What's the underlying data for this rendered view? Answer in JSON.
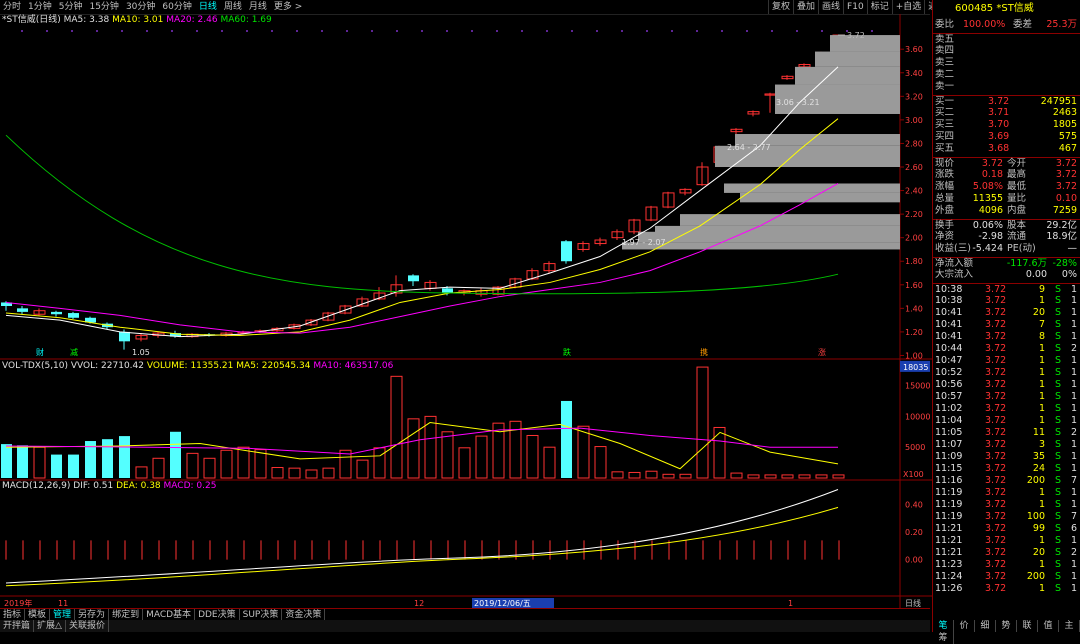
{
  "toolbar": {
    "periods": [
      "分时",
      "1分钟",
      "5分钟",
      "15分钟",
      "30分钟",
      "60分钟",
      "日线",
      "周线",
      "月线",
      "更多 >"
    ],
    "active": "日线",
    "right_buttons": [
      "复权",
      "叠加",
      "画线",
      "F10",
      "标记",
      "+自选",
      "返回"
    ]
  },
  "main_chart": {
    "legend": {
      "name": "*ST信威(日线)",
      "ma5": "MA5: 3.38",
      "ma10": "MA10: 3.01",
      "ma20": "MA20: 2.46",
      "ma60": "MA60: 1.69"
    },
    "y_ticks": [
      "3.60",
      "3.40",
      "3.20",
      "3.00",
      "2.80",
      "2.60",
      "2.40",
      "2.20",
      "2.00",
      "1.80",
      "1.60",
      "1.40",
      "1.20",
      "1.00"
    ],
    "annotations": {
      "top_price": "3.72",
      "a1": "3.06 - 3.21",
      "a2": "2.64 - 2.77",
      "a3": "1.97 - 2.07",
      "low": "1.05"
    },
    "markers": [
      "财",
      "减",
      "跌",
      "携",
      "涨"
    ]
  },
  "volume_chart": {
    "legend": {
      "name": "VOL-TDX(5,10)",
      "vvol": "VVOL: 22710.42",
      "volume": "VOLUME: 11355.21",
      "ma5": "MA5: 220545.34",
      "ma10": "MA10: 463517.06"
    },
    "y_ticks": [
      "15000",
      "10000",
      "5000"
    ],
    "highlight_value": "18035",
    "unit": "X100"
  },
  "macd_chart": {
    "legend": {
      "name": "MACD(12,26,9)",
      "dif": "DIF: 0.51",
      "dea": "DEA: 0.38",
      "macd": "MACD: 0.25"
    },
    "y_ticks": [
      "0.40",
      "0.20",
      "0.00"
    ]
  },
  "date_axis": {
    "labels": [
      "2019年",
      "11",
      "12",
      "2019/12/06/五",
      "1"
    ],
    "right_label": "日线"
  },
  "bottom_tabs": [
    "指标",
    "模板",
    "管理",
    "另存为",
    "绑定到",
    "MACD基本",
    "DDE决策",
    "SUP决策",
    "资金决策"
  ],
  "bottom_tabs_active": "管理",
  "bottom_tabs2": [
    "开拌篇",
    "扩展△",
    "关联报价"
  ],
  "quote": {
    "code_name": "600485 *ST信威",
    "weibi_label": "委比",
    "weibi": "100.00%",
    "weicha_label": "委差",
    "weicha": "25.3万",
    "asks": [
      {
        "label": "卖五",
        "price": "",
        "vol": ""
      },
      {
        "label": "卖四",
        "price": "",
        "vol": ""
      },
      {
        "label": "卖三",
        "price": "",
        "vol": ""
      },
      {
        "label": "卖二",
        "price": "",
        "vol": ""
      },
      {
        "label": "卖一",
        "price": "",
        "vol": ""
      }
    ],
    "bids": [
      {
        "label": "买一",
        "price": "3.72",
        "vol": "247951"
      },
      {
        "label": "买二",
        "price": "3.71",
        "vol": "2463"
      },
      {
        "label": "买三",
        "price": "3.70",
        "vol": "1805"
      },
      {
        "label": "买四",
        "price": "3.69",
        "vol": "575"
      },
      {
        "label": "买五",
        "price": "3.68",
        "vol": "467"
      }
    ],
    "stats": [
      {
        "l1": "现价",
        "v1": "3.72",
        "l2": "今开",
        "v2": "3.72"
      },
      {
        "l1": "涨跌",
        "v1": "0.18",
        "l2": "最高",
        "v2": "3.72"
      },
      {
        "l1": "涨幅",
        "v1": "5.08%",
        "l2": "最低",
        "v2": "3.72"
      },
      {
        "l1": "总量",
        "v1": "11355",
        "l2": "量比",
        "v2": "0.10"
      },
      {
        "l1": "外盘",
        "v1": "4096",
        "l2": "内盘",
        "v2": "7259"
      }
    ],
    "stats2": [
      {
        "l1": "换手",
        "v1": "0.06%",
        "l2": "股本",
        "v2": "29.2亿"
      },
      {
        "l1": "净资",
        "v1": "-2.98",
        "l2": "流通",
        "v2": "18.9亿"
      },
      {
        "l1": "收益(三)",
        "v1": "-5.424",
        "l2": "PE(动)",
        "v2": "—"
      }
    ],
    "flow": [
      {
        "label": "净流入额",
        "v1": "-117.6万",
        "v2": "-28%"
      },
      {
        "label": "大宗流入",
        "v1": "0.00",
        "v2": "0%"
      }
    ],
    "ticks": [
      [
        "10:38",
        "3.72",
        "9",
        "S",
        "1"
      ],
      [
        "10:38",
        "3.72",
        "1",
        "S",
        "1"
      ],
      [
        "10:41",
        "3.72",
        "20",
        "S",
        "1"
      ],
      [
        "10:41",
        "3.72",
        "7",
        "S",
        "1"
      ],
      [
        "10:41",
        "3.72",
        "8",
        "S",
        "1"
      ],
      [
        "10:44",
        "3.72",
        "1",
        "S",
        "2"
      ],
      [
        "10:47",
        "3.72",
        "1",
        "S",
        "1"
      ],
      [
        "10:52",
        "3.72",
        "1",
        "S",
        "1"
      ],
      [
        "10:56",
        "3.72",
        "1",
        "S",
        "1"
      ],
      [
        "10:57",
        "3.72",
        "1",
        "S",
        "1"
      ],
      [
        "11:02",
        "3.72",
        "1",
        "S",
        "1"
      ],
      [
        "11:04",
        "3.72",
        "1",
        "S",
        "1"
      ],
      [
        "11:05",
        "3.72",
        "11",
        "S",
        "2"
      ],
      [
        "11:07",
        "3.72",
        "3",
        "S",
        "1"
      ],
      [
        "11:09",
        "3.72",
        "35",
        "S",
        "1"
      ],
      [
        "11:15",
        "3.72",
        "24",
        "S",
        "1"
      ],
      [
        "11:16",
        "3.72",
        "200",
        "S",
        "7"
      ],
      [
        "11:19",
        "3.72",
        "1",
        "S",
        "1"
      ],
      [
        "11:19",
        "3.72",
        "1",
        "S",
        "1"
      ],
      [
        "11:19",
        "3.72",
        "100",
        "S",
        "7"
      ],
      [
        "11:21",
        "3.72",
        "99",
        "S",
        "6"
      ],
      [
        "11:21",
        "3.72",
        "1",
        "S",
        "1"
      ],
      [
        "11:21",
        "3.72",
        "20",
        "S",
        "2"
      ],
      [
        "11:23",
        "3.72",
        "1",
        "S",
        "1"
      ],
      [
        "11:24",
        "3.72",
        "200",
        "S",
        "1"
      ],
      [
        "11:26",
        "3.72",
        "1",
        "S",
        "1"
      ]
    ],
    "tabs": [
      "笔",
      "价",
      "细",
      "势",
      "联",
      "值",
      "主",
      "筹"
    ]
  },
  "colors": {
    "up": "#ff3232",
    "down": "#54ffff",
    "ma5": "#ffffff",
    "ma10": "#ffff00",
    "ma20": "#ff00ff",
    "ma60": "#00c000",
    "grid": "#8b0000"
  }
}
